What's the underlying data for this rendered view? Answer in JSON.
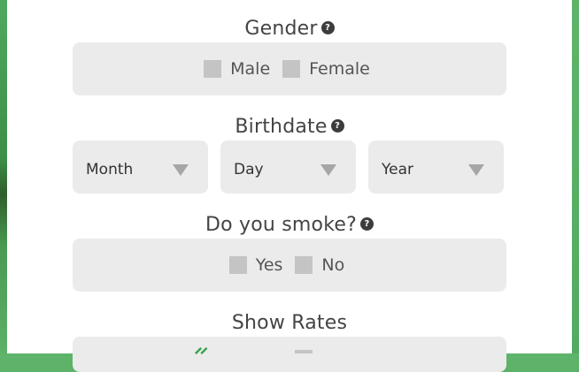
{
  "gender": {
    "title": "Gender",
    "help": "?",
    "options": [
      "Male",
      "Female"
    ]
  },
  "birthdate": {
    "title": "Birthdate",
    "help": "?",
    "month_label": "Month",
    "day_label": "Day",
    "year_label": "Year"
  },
  "smoke": {
    "title": "Do you smoke?",
    "help": "?",
    "options": [
      "Yes",
      "No"
    ]
  },
  "show_rates": {
    "title": "Show Rates"
  },
  "colors": {
    "background_green": "#4aa55a",
    "box": "#ebebeb",
    "checkbox": "#c4c4c4",
    "accent_green": "#3aa14b"
  }
}
